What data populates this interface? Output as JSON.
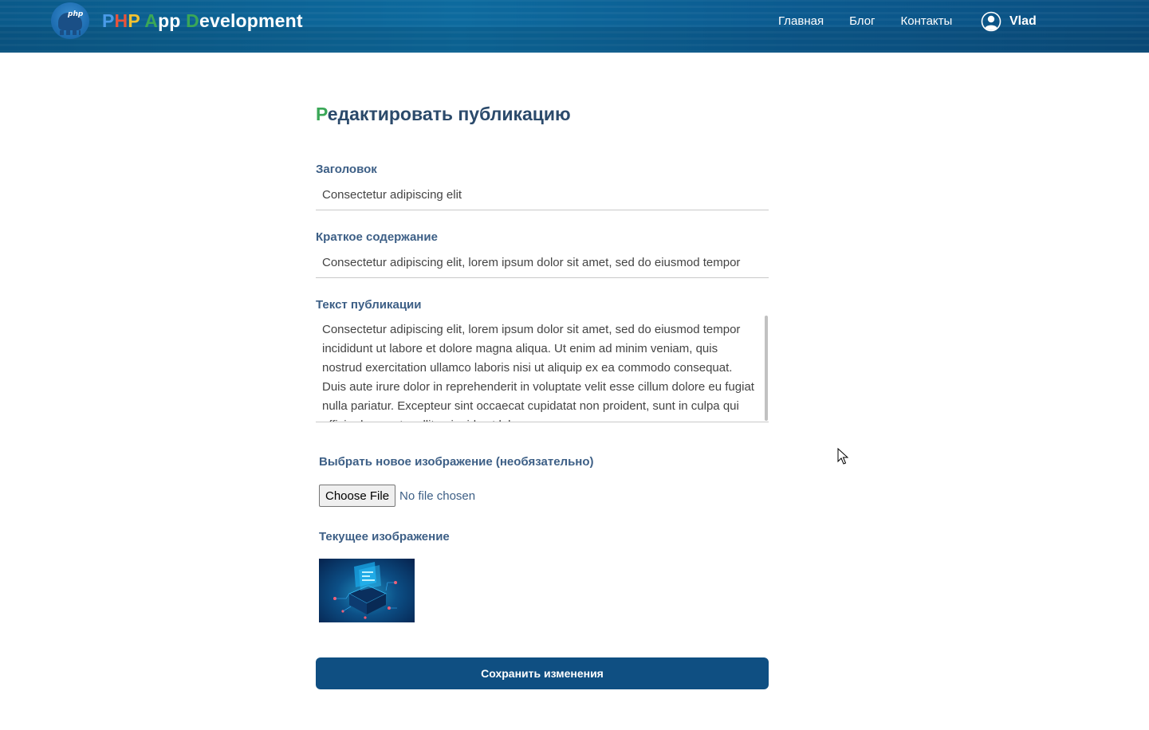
{
  "header": {
    "brand_letters": [
      {
        "text": "P",
        "color": "#4a9be8"
      },
      {
        "text": "H",
        "color": "#e8543c"
      },
      {
        "text": "P",
        "color": "#f2c230"
      },
      {
        "text": " ",
        "color": "#ffffff"
      },
      {
        "text": "A",
        "color": "#3aa757"
      },
      {
        "text": "pp ",
        "color": "#ffffff"
      },
      {
        "text": "D",
        "color": "#3aa757"
      },
      {
        "text": "evelopment",
        "color": "#ffffff"
      }
    ],
    "logo_text": "php",
    "nav": {
      "home": "Главная",
      "blog": "Блог",
      "contacts": "Контакты"
    },
    "user_name": "Vlad"
  },
  "form": {
    "title_first_letter": "Р",
    "title_rest": "едактировать публикацию",
    "title_field": {
      "label": "Заголовок",
      "value": "Consectetur adipiscing elit"
    },
    "summary_field": {
      "label": "Краткое содержание",
      "value": "Consectetur adipiscing elit, lorem ipsum dolor sit amet, sed do eiusmod tempor"
    },
    "body_field": {
      "label": "Текст публикации",
      "value": "Consectetur adipiscing elit, lorem ipsum dolor sit amet, sed do eiusmod tempor incididunt ut labore et dolore magna aliqua. Ut enim ad minim veniam, quis nostrud exercitation ullamco laboris nisi ut aliquip ex ea commodo consequat. Duis aute irure dolor in reprehenderit in voluptate velit esse cillum dolore eu fugiat nulla pariatur. Excepteur sint occaecat cupidatat non proident, sunt in culpa qui officia deserunt mollit anim id est laborum."
    },
    "image_field": {
      "label": "Выбрать новое изображение (необязательно)",
      "button": "Choose File",
      "status": "No file chosen"
    },
    "current_image_label": "Текущее изображение",
    "save_button": "Сохранить изменения"
  },
  "colors": {
    "header_bg": "#0b5c8f",
    "accent_green": "#3aa757",
    "save_button_bg": "#0f4f82",
    "label_text": "#3d5f86"
  }
}
